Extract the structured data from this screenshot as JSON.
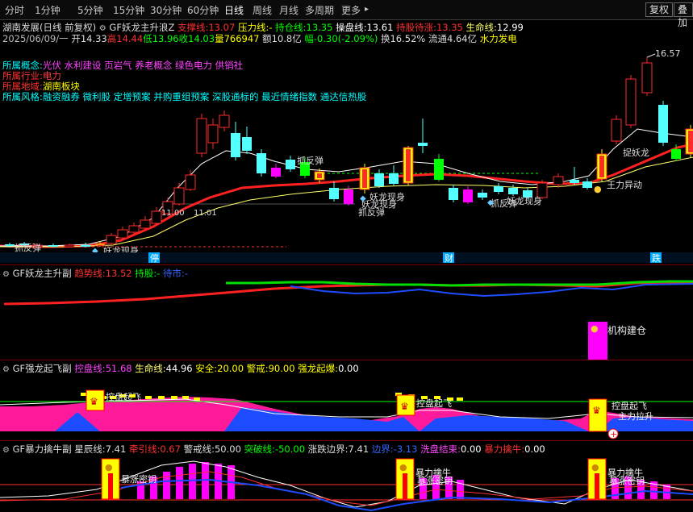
{
  "toolbar": {
    "periods": [
      "分时",
      "1分钟",
      "5分钟",
      "15分钟",
      "30分钟",
      "60分钟",
      "日线",
      "周线",
      "月线",
      "多周期",
      "更多"
    ],
    "active": "日线",
    "more_arrow": "▸",
    "restore_label": "复权",
    "overlay_label": "叠加"
  },
  "header": {
    "stock_name": "湖南发展(日线 前复权)",
    "indicator_name": "GF妖龙主升浪Z",
    "support_label": "支撑线:",
    "support_value": "13.07",
    "pressure_label": "压力线:",
    "pressure_value": "-",
    "hold_label": "持仓线:",
    "hold_value": "13.35",
    "control_label": "操盘线:",
    "control_value": "13.61",
    "wait_label": "持股待涨:",
    "wait_value": "13.35",
    "life_label": "生命线:",
    "life_value": "12.99",
    "date": "2025/06/09/一",
    "open": "开14.33",
    "high": "高14.44",
    "low": "低13.96",
    "close": "收14.03",
    "volume": "量766947",
    "amount": "额10.8亿",
    "change": "幅-0.30(-2.09%)",
    "turnover": "换16.52%",
    "float": "流通4.64亿",
    "sector": "水力发电"
  },
  "info": {
    "concept_label": "所属概念:",
    "concept_value": "光伏 水利建设 页岩气 养老概念 绿色电力 供销社",
    "industry_label": "所属行业:",
    "industry_value": "电力",
    "region_label": "所属地域:",
    "region_value": "湖南板块",
    "style_label": "所属风格:",
    "style_value": "融资融券 微利股 定增预案 并购重组预案 深股通标的 最近情绪指数 通达信热股"
  },
  "main_chart": {
    "max_label": "16.57",
    "level_labels": [
      "11.00",
      "11.01"
    ],
    "annotations": [
      "抓反弹",
      "抓反弹",
      "妖龙现身",
      "妖龙现身",
      "抓反弹",
      "妖龙现身",
      "捉妖龙",
      "王力异动",
      "抓反弹"
    ],
    "bottom_markers": [
      "停",
      "财",
      "跌"
    ],
    "left_badge": "妖龙现身"
  },
  "panel1": {
    "title": "GF妖龙主升副",
    "trend_label": "趋势线:",
    "trend_value": "13.52",
    "hold_label": "持股:",
    "hold_value": "-",
    "wait_label": "待市:",
    "wait_value": "-",
    "label_build": "机构建仓"
  },
  "panel2": {
    "title": "GF强龙起飞副",
    "control_label": "控盘线:",
    "control_value": "51.68",
    "life_label": "生命线:",
    "life_value": "44.96",
    "safe_label": "安全:",
    "safe_value": "20.00",
    "alert_label": "警戒:",
    "alert_value": "90.00",
    "burst_label": "强龙起爆:",
    "burst_value": "0.00",
    "flags": [
      "控盘起飞",
      "控盘起飞",
      "控盘起飞"
    ],
    "ascend_text": "主力拉升"
  },
  "panel3": {
    "title": "GF暴力擒牛副",
    "star_label": "星辰线:",
    "star_value": "7.41",
    "pull_label": "牵引线:",
    "pull_value": "0.67",
    "warn_label": "警戒线:",
    "warn_value": "50.00",
    "break_label": "突破线:",
    "break_value": "-50.00",
    "bound_label": "涨跌边界:",
    "bound_value": "7.41",
    "edge_label": "边界:",
    "edge_value": "-3.13",
    "wash_label": "洗盘结束:",
    "wash_value": "0.00",
    "bull_label": "暴力擒牛:",
    "bull_value": "0.00",
    "flags": [
      "暴涨密钥",
      "暴力擒牛",
      "暴涨密钥",
      "暴力擒牛",
      "暴涨密钥"
    ]
  },
  "colors": {
    "up": "#ff2a2a",
    "down": "#54ffff",
    "yellow": "#ffff00",
    "green": "#00ff00",
    "magenta": "#ff00ff",
    "blue": "#1d4cff",
    "pink": "#ff3ca8"
  }
}
